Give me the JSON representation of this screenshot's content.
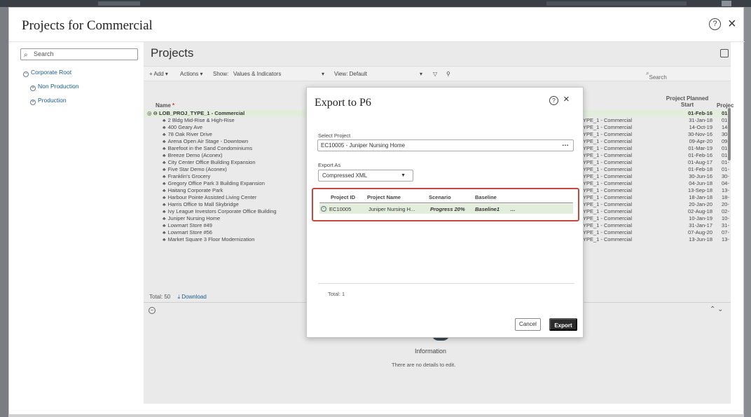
{
  "window": {
    "title": "Projects for Commercial"
  },
  "left_panel": {
    "search_placeholder": "Search",
    "tree": [
      {
        "label": "Corporate Root"
      },
      {
        "label": "Non Production"
      },
      {
        "label": "Production"
      }
    ]
  },
  "main": {
    "title": "Projects",
    "toolbar": {
      "add": "+ Add ▾",
      "actions": "Actions ▾",
      "show": "Show:",
      "show_value": "Values & Indicators",
      "view": "View: Default",
      "search_placeholder": "Search"
    },
    "columns": {
      "name": "Name",
      "planned_start": "Project Planned Start",
      "project": "Projec"
    },
    "group_row": {
      "name": "LOB_PROJ_TYPE_1 - Commercial",
      "start": "01-Feb-16",
      "proj": "01-"
    },
    "rows": [
      {
        "name": "2 Bldg Mid-Rise & High-Rise",
        "type": "YPE_1 - Commercial",
        "start": "31-Jan-18",
        "proj": "01-"
      },
      {
        "name": "400 Geary Ave",
        "type": "YPE_1 - Commercial",
        "start": "14-Oct-19",
        "proj": "14-"
      },
      {
        "name": "78 Oak River Drive",
        "type": "YPE_1 - Commercial",
        "start": "30-Nov-16",
        "proj": "30-"
      },
      {
        "name": "Arena Open Air Stage - Downtown",
        "type": "YPE_1 - Commercial",
        "start": "09-Apr-20",
        "proj": "09-"
      },
      {
        "name": "Barefoot in the Sand Condominiums",
        "type": "YPE_1 - Commercial",
        "start": "01-Mar-19",
        "proj": "01-"
      },
      {
        "name": "Breeze Demo (Aconex)",
        "type": "YPE_1 - Commercial",
        "start": "01-Feb-16",
        "proj": "01-"
      },
      {
        "name": "City Center Office Building Expansion",
        "type": "YPE_1 - Commercial",
        "start": "01-Aug-17",
        "proj": "01-"
      },
      {
        "name": "Five Star Demo (Aconex)",
        "type": "YPE_1 - Commercial",
        "start": "01-Feb-18",
        "proj": "01-"
      },
      {
        "name": "Franklin's Grocery",
        "type": "YPE_1 - Commercial",
        "start": "30-Jun-16",
        "proj": "30-"
      },
      {
        "name": "Gregory Office Park 3 Building Expansion",
        "type": "YPE_1 - Commercial",
        "start": "04-Jun-18",
        "proj": "04-"
      },
      {
        "name": "Haitang Corporate Park",
        "type": "YPE_1 - Commercial",
        "start": "13-Sep-18",
        "proj": "13-"
      },
      {
        "name": "Harbour Pointe Assisted Living Center",
        "type": "YPE_1 - Commercial",
        "start": "18-Jan-18",
        "proj": "18-"
      },
      {
        "name": "Harris Office to Mall Skybridge",
        "type": "YPE_1 - Commercial",
        "start": "20-Jan-20",
        "proj": "20-"
      },
      {
        "name": "Ivy League Investors Corporate Office Building",
        "type": "YPE_1 - Commercial",
        "start": "02-Aug-18",
        "proj": "02-"
      },
      {
        "name": "Juniper Nursing Home",
        "type": "YPE_1 - Commercial",
        "start": "10-Jan-19",
        "proj": "10-"
      },
      {
        "name": "Lowmart Store #49",
        "type": "YPE_1 - Commercial",
        "start": "31-Jan-17",
        "proj": "31-"
      },
      {
        "name": "Lowmart Store #56",
        "type": "YPE_1 - Commercial",
        "start": "07-Aug-20",
        "proj": "07-"
      },
      {
        "name": "Market Square 3 Floor Modernization",
        "type": "YPE_1 - Commercial",
        "start": "13-Jun-18",
        "proj": "13-"
      }
    ],
    "footer": {
      "total": "Total: 50",
      "download": "Download"
    },
    "info": {
      "title": "Information",
      "subtitle": "There are no details to edit."
    }
  },
  "dialog": {
    "title": "Export to P6",
    "select_project_label": "Select Project",
    "select_project_value": "EC10005 - Juniper Nursing Home",
    "export_as_label": "Export As",
    "export_as_value": "Compressed XML",
    "grid": {
      "headers": {
        "id": "Project ID",
        "name": "Project Name",
        "scenario": "Scenario",
        "baseline": "Baseline"
      },
      "row": {
        "id": "EC10005",
        "name": "Juniper Nursing H...",
        "scenario": "Progress 20%",
        "baseline": "Baseline1"
      }
    },
    "total": "Total: 1",
    "cancel": "Cancel",
    "export": "Export"
  },
  "colors": {
    "highlight_border": "#c9473f",
    "selected_row": "#e2eddc",
    "export_button": "#2b2b2b"
  }
}
